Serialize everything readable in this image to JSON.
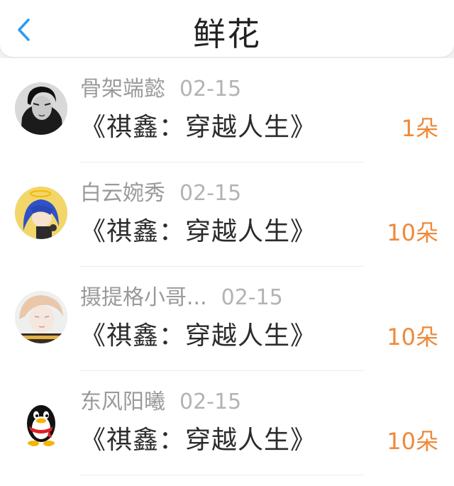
{
  "header": {
    "title": "鲜花",
    "back_icon": "chevron-left-icon",
    "accent_color": "#2b9bf0"
  },
  "items": [
    {
      "user": "骨架端懿",
      "date": "02-15",
      "book": "《祺鑫：穿越人生》",
      "count": "1朵"
    },
    {
      "user": "白云婉秀",
      "date": "02-15",
      "book": "《祺鑫：穿越人生》",
      "count": "10朵"
    },
    {
      "user": "摄提格小哥...",
      "date": "02-15",
      "book": "《祺鑫：穿越人生》",
      "count": "10朵"
    },
    {
      "user": "东风阳曦",
      "date": "02-15",
      "book": "《祺鑫：穿越人生》",
      "count": "10朵"
    }
  ],
  "colors": {
    "count": "#ee8a3a",
    "name": "#9a9a9a",
    "book": "#2b2b2b"
  }
}
